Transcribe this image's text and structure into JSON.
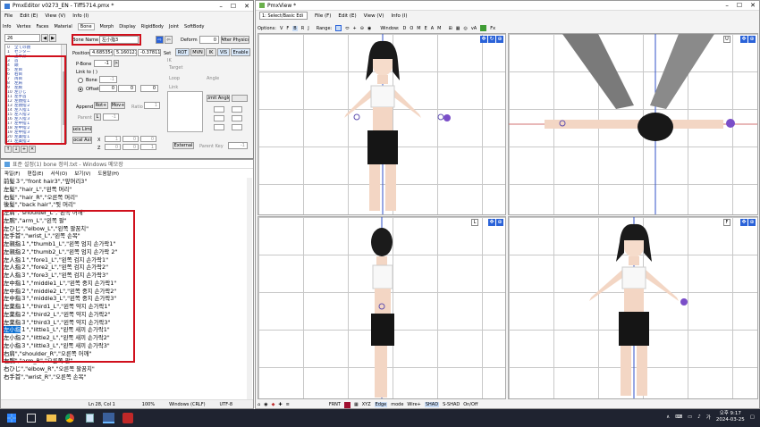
{
  "pmx": {
    "title": "PmxEditor v0273_EN - Tiff5714.pmx *",
    "menu": [
      "File",
      "Edit (E)",
      "View (V)",
      "Info (I)"
    ],
    "tabs": [
      "Info",
      "Vertex",
      "Faces",
      "Material",
      "Bone",
      "Morph",
      "Display",
      "RigidBody",
      "Joint",
      "SoftBody"
    ],
    "search_value": "26",
    "bone_list": [
      {
        "idx": "0",
        "name": "全ての親"
      },
      {
        "idx": "1",
        "name": "センター"
      },
      {
        "idx": "2",
        "name": "上半身"
      },
      {
        "idx": "3",
        "name": "首"
      },
      {
        "idx": "4",
        "name": "頭"
      },
      {
        "idx": "5",
        "name": "左目"
      },
      {
        "idx": "6",
        "name": "右目"
      },
      {
        "idx": "7",
        "name": "両目"
      },
      {
        "idx": "8",
        "name": "左肩"
      },
      {
        "idx": "9",
        "name": "左腕"
      },
      {
        "idx": "10",
        "name": "左ひじ"
      },
      {
        "idx": "11",
        "name": "左手首"
      },
      {
        "idx": "12",
        "name": "左親指１"
      },
      {
        "idx": "13",
        "name": "左親指２"
      },
      {
        "idx": "14",
        "name": "左人指１"
      },
      {
        "idx": "15",
        "name": "左人指２"
      },
      {
        "idx": "16",
        "name": "左人指３"
      },
      {
        "idx": "17",
        "name": "左中指１"
      },
      {
        "idx": "18",
        "name": "左中指２"
      },
      {
        "idx": "19",
        "name": "左中指３"
      },
      {
        "idx": "20",
        "name": "左薬指１"
      },
      {
        "idx": "21",
        "name": "左薬指２"
      },
      {
        "idx": "22",
        "name": "左薬指３"
      },
      {
        "idx": "23",
        "name": "左小指１"
      },
      {
        "idx": "24",
        "name": "左小指２"
      },
      {
        "idx": "25",
        "name": "左小指３"
      }
    ],
    "bone_name_label": "Bone Name",
    "bone_name_value": "左小指3",
    "deform_label": "Deform",
    "deform_value": "0",
    "after_physics": "After Physics",
    "position_label": "Position",
    "pos_x": "4.685354",
    "pos_y": "5.160121",
    "pos_z": "-0.378117",
    "set_label": "Set",
    "rot": "ROT",
    "mvn": "MVN",
    "ik": "IK",
    "vis": "VIS",
    "enable": "Enable",
    "pbone_label": "P-Bone",
    "pbone_value": "-1",
    "link_to_label": "Link to ( )",
    "bone_radio": "Bone",
    "bone_radio_value": "-1",
    "offset_radio": "Offset",
    "off_x": "0",
    "off_y": "0",
    "off_z": "0",
    "ik_label": "IK",
    "target_label": "Target",
    "loop_label": "Loop",
    "angle_label": "Angle",
    "link_label": "Link",
    "limit_angle": "Limit Angle",
    "append_label": "Append",
    "rot_plus": "Rot+",
    "mov_plus": "Mov+",
    "ratio_label": "Ratio",
    "ratio_value": "1",
    "parent_label": "Parent",
    "parent_value": "-1",
    "axis_limit": "Axis Limit",
    "local_axis": "Local Axis",
    "x_label": "X",
    "z_label": "Z",
    "zero": "0",
    "one": "1",
    "external": "External",
    "parent_key_label": "Parent Key",
    "parent_key_value": "-1"
  },
  "notepad": {
    "title": "표준 설정(1) bone 정의.txt - Windows 메모장",
    "menu": [
      "파일(F)",
      "편집(E)",
      "서식(O)",
      "보기(V)",
      "도움말(H)"
    ],
    "lines": [
      "前髪３\",\"front hair3\",\"앞머리3\"",
      "左髪\",\"hair_L\",\"왼쪽 머리\"",
      "右髪\",\"hair_R\",\"오른쪽 머리\"",
      "後髪\",\"back hair\",\"뒷 머리\"",
      "左肩\",\"shoulder_L\",\"왼쪽 어깨\"",
      "左腕\",\"arm_L\",\"왼쪽 팔\"",
      "左ひじ\",\"elbow_L\",\"왼쪽 팔꿈치\"",
      "左手首\",\"wrist_L\",\"왼쪽 손목\"",
      "左親指１\",\"thumb1_L\",\"왼쪽 엄지 손가락1\"",
      "左親指２\",\"thumb2_L\",\"왼쪽 엄지 손가락 2\"",
      "左人指１\",\"fore1_L\",\"왼쪽 검지 손가락1\"",
      "左人指２\",\"fore2_L\",\"왼쪽 검지 손가락2\"",
      "左人指３\",\"fore3_L\",\"왼쪽 검지 손가락3\"",
      "左中指１\",\"middle1_L\",\"왼쪽 중지 손가락1\"",
      "左中指２\",\"middle2_L\",\"왼쪽 중지 손가락2\"",
      "左中指３\",\"middle3_L\",\"왼쪽 중지 손가락3\"",
      "左薬指１\",\"third1_L\",\"왼쪽 약지 손가락1\"",
      "左薬指２\",\"third2_L\",\"왼쪽 약지 손가락2\"",
      "左薬指３\",\"third3_L\",\"왼쪽 약지 손가락3\"",
      "左小指１\",\"little1_L\",\"왼쪽 새끼 손가락1\"",
      "左小指２\",\"little2_L\",\"왼쪽 새끼 손가락2\"",
      "左小指３\",\"little3_L\",\"왼쪽 새끼 손가락3\"",
      "右肩\",\"shoulder_R\",\"오른쪽 어깨\"",
      "右腕\",\"arm_R\",\"오른쪽 팔\"",
      "右ひじ\",\"elbow_R\",\"오른쪽 팔꿈치\"",
      "右手首\",\"wrist_R\",\"오른쪽 손목\""
    ],
    "selected_line_prefix": "左小指",
    "status_pos": "Ln 28, Col 1",
    "status_zoom": "100%",
    "status_eol": "Windows (CRLF)",
    "status_enc": "UTF-8"
  },
  "pmxview": {
    "title": "PmxView *",
    "mode_select": "1: Select/Basic Edi",
    "menu": [
      "File (F)",
      "Edit (E)",
      "View (V)",
      "Info (I)"
    ],
    "options_label": "Options:",
    "options": [
      "V",
      "F",
      "B",
      "R",
      "J"
    ],
    "range_label": "Range:",
    "window_label": "Window:",
    "window_items": [
      "D",
      "O",
      "M",
      "E",
      "A",
      "M"
    ],
    "fx": "Fx",
    "view_letters": [
      "U",
      "L",
      "F"
    ],
    "bottom_bar": [
      "FRNT",
      "XYZ",
      "Edge",
      "mode",
      "Wire+",
      "SHAD",
      "S-SHAD",
      "On/Off"
    ]
  },
  "taskbar": {
    "time": "오후 9:17",
    "date": "2024-03-25",
    "ime": "가"
  },
  "colors": {
    "accent": "#2a62d8",
    "selection": "#0a6ed1",
    "redbox": "#d0101c",
    "taskbar": "#1f2330"
  }
}
